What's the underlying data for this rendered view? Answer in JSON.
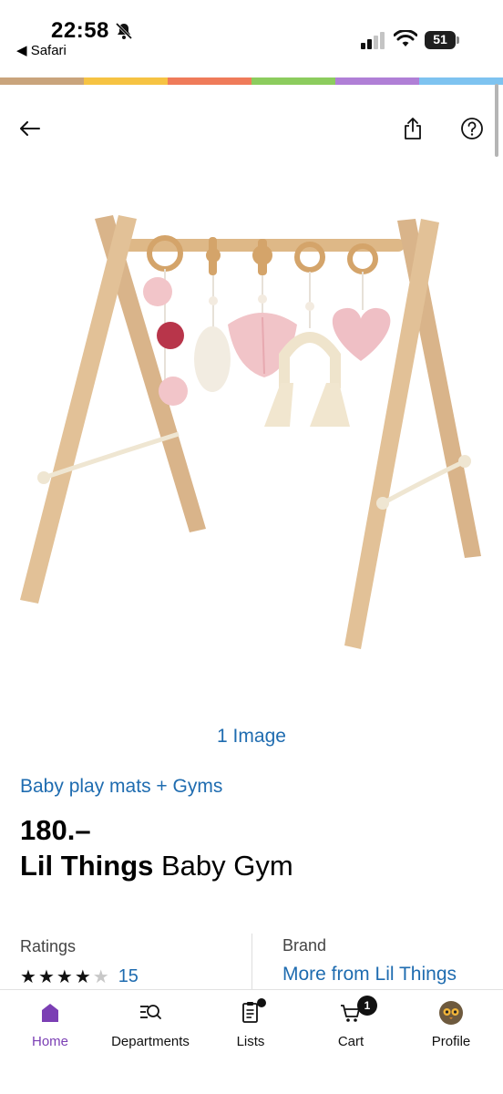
{
  "status_bar": {
    "time": "22:58",
    "back_app": "◀ Safari",
    "battery": "51"
  },
  "rainbow_colors": [
    "#c9a47c",
    "#f6c343",
    "#ef7b5a",
    "#8ccc5e",
    "#b07fd6",
    "#7ec3f0"
  ],
  "header": {
    "back_icon": "arrow-left-icon",
    "share_icon": "share-icon",
    "help_icon": "help-circle-icon"
  },
  "product": {
    "image_count": "1 Image",
    "category": "Baby play mats + Gyms",
    "price": "180.–",
    "brand": "Lil Things",
    "name": "Baby Gym"
  },
  "info": {
    "ratings_label": "Ratings",
    "rating_stars": 4,
    "rating_max": 5,
    "rating_count": "15",
    "brand_label": "Brand",
    "brand_link": "More from Lil Things"
  },
  "nav": {
    "items": [
      {
        "label": "Home",
        "icon": "home-icon",
        "active": true
      },
      {
        "label": "Departments",
        "icon": "departments-search-icon"
      },
      {
        "label": "Lists",
        "icon": "list-icon"
      },
      {
        "label": "Cart",
        "icon": "cart-icon",
        "badge": "1"
      },
      {
        "label": "Profile",
        "icon": "avatar-icon"
      }
    ]
  },
  "colors": {
    "link": "#1f6cb0",
    "active_nav": "#7b3fb4"
  }
}
